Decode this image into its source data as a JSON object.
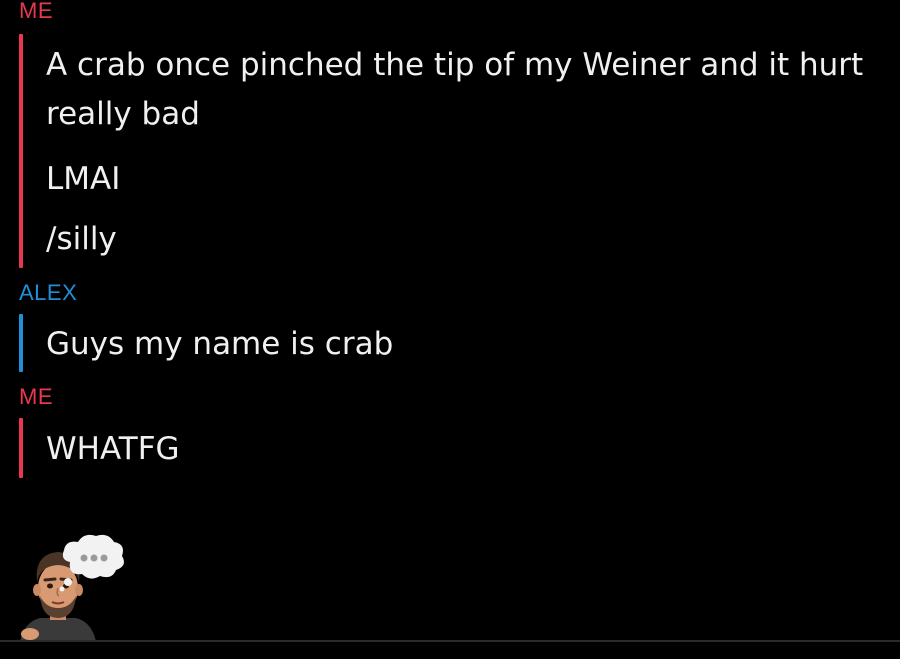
{
  "colors": {
    "background": "#000000",
    "me": "#e8384f",
    "alex": "#1f8fd8",
    "text": "#f0f0f0"
  },
  "groups": [
    {
      "sender": "ME",
      "messages": [
        "A crab once pinched the tip of my Weiner and it hurt really bad",
        "LMAI",
        "/silly"
      ]
    },
    {
      "sender": "ALEX",
      "messages": [
        "Guys my name is crab"
      ]
    },
    {
      "sender": "ME",
      "messages": [
        "WHATFG"
      ]
    }
  ],
  "typing_indicator": {
    "avatar": "bitmoji-avatar-icon",
    "bubble": "thought-bubble-icon",
    "dots": "..."
  }
}
